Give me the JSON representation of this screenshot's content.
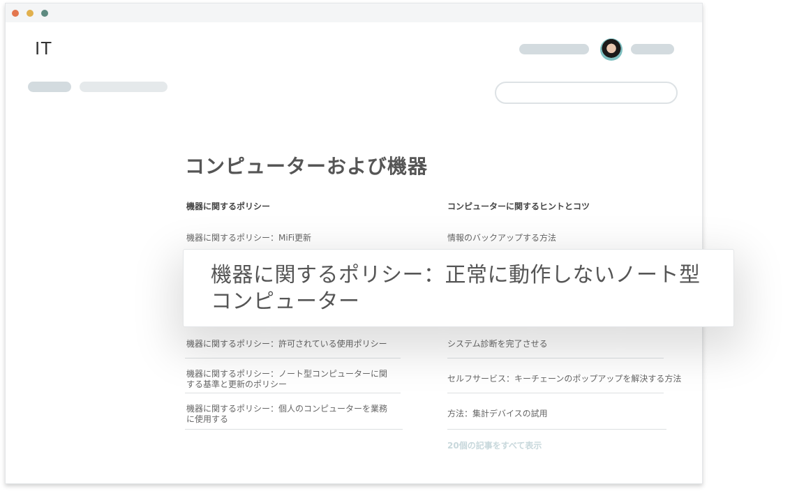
{
  "window": {
    "title": "IT"
  },
  "section": {
    "title": "コンピューターおよび機器"
  },
  "columns": [
    {
      "heading": "機器に関するポリシー",
      "links": [
        "機器に関するポリシー：MiFi更新",
        "機器に関するポリシー：許可されている使用ポリシー",
        "機器に関するポリシー：ノート型コンピューターに関する基準と更新のポリシー",
        "機器に関するポリシー：個人のコンピューターを業務に使用する"
      ]
    },
    {
      "heading": "コンピューターに関するヒントとコツ",
      "links": [
        "情報のバックアップする方法",
        "システム診断を完了させる",
        "セルフサービス：キーチェーンのポップアップを解決する方法",
        "方法：集計デバイスの試用"
      ],
      "view_all": "20個の記事をすべて表示"
    }
  ],
  "highlight": {
    "text": "機器に関するポリシー：正常に動作しないノート型コンピューター"
  },
  "icons": {
    "window_controls": [
      "close-dot",
      "minimize-dot",
      "maximize-dot"
    ],
    "avatar": "user-avatar"
  },
  "colors": {
    "close": "#e3774f",
    "minimize": "#e1b04d",
    "maximize": "#5e8a80",
    "placeholder": "#d3dbdf"
  }
}
